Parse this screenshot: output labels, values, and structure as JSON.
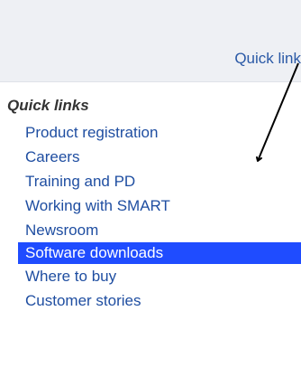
{
  "header": {
    "quick_link_label": "Quick link"
  },
  "quick_links": {
    "title": "Quick links",
    "items": [
      {
        "label": "Product registration"
      },
      {
        "label": "Careers"
      },
      {
        "label": "Training and PD"
      },
      {
        "label": "Working with SMART"
      },
      {
        "label": "Newsroom"
      },
      {
        "label": "Software downloads",
        "active": true
      },
      {
        "label": "Where to buy"
      },
      {
        "label": "Customer stories"
      }
    ]
  },
  "colors": {
    "link": "#1f4ea1",
    "active_bg": "#1f4cff",
    "header_bg": "#eef0f4"
  },
  "annotation_icon": "arrow-icon"
}
